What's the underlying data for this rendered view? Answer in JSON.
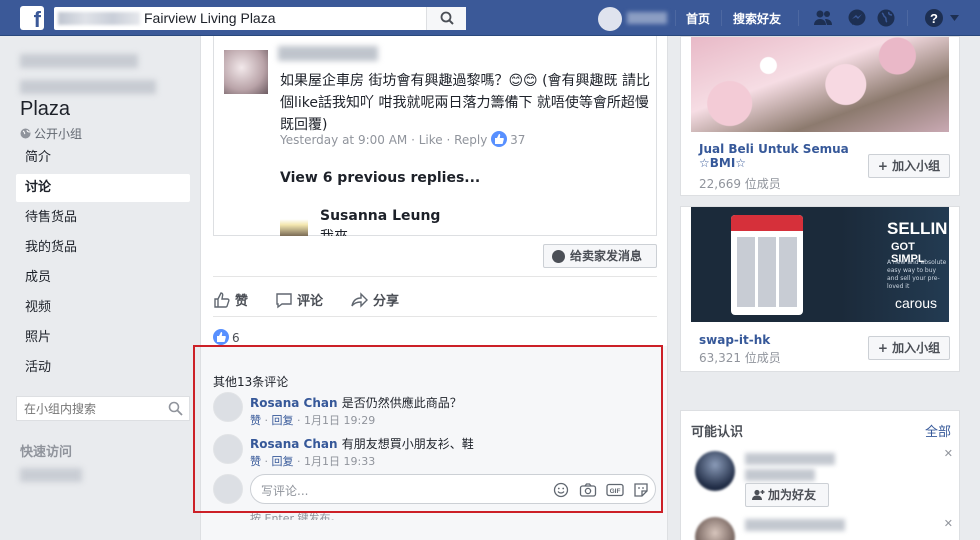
{
  "header": {
    "search_value": "Fairview Living Plaza",
    "nav_home": "首页",
    "nav_find_friends": "搜索好友"
  },
  "sidebar": {
    "group_name": "Plaza",
    "group_type": "公开小组",
    "items": [
      {
        "label": "简介",
        "active": false
      },
      {
        "label": "讨论",
        "active": true
      },
      {
        "label": "待售货品",
        "active": false
      },
      {
        "label": "我的货品",
        "active": false
      },
      {
        "label": "成员",
        "active": false
      },
      {
        "label": "视频",
        "active": false
      },
      {
        "label": "照片",
        "active": false
      },
      {
        "label": "活动",
        "active": false
      }
    ],
    "search_placeholder": "在小组内搜索",
    "quick_access": "快速访问"
  },
  "post": {
    "comment_text": "如果屋企車房 街坊會有興趣過黎嗎？😊😊 (會有興趣既 請比個like話我知吖 咁我就呢兩日落力籌備下 就唔使等會所超慢既回覆)",
    "comment_time": "Yesterday at 9:00 AM",
    "comment_like": "Like",
    "comment_reply": "Reply",
    "comment_likes": "37",
    "view_previous": "View 6 previous replies...",
    "reply_author": "Susanna Leung",
    "reply_text": "我來",
    "message_seller": "给卖家发消息",
    "actions": {
      "like": "赞",
      "comment": "评论",
      "share": "分享"
    },
    "likes_count": "6"
  },
  "comments": {
    "more_label": "其他13条评论",
    "items": [
      {
        "author": "Rosana Chan",
        "text": "是否仍然供應此商品？",
        "like": "赞",
        "reply": "回复",
        "time": "1月1日 19:29"
      },
      {
        "author": "Rosana Chan",
        "text": "有朋友想買小朋友衫、鞋",
        "like": "赞",
        "reply": "回复",
        "time": "1月1日 19:33"
      }
    ],
    "input_placeholder": "写评论...",
    "press_enter": "按 Enter 键发布。"
  },
  "right": {
    "groups": [
      {
        "name": "Jual Beli Untuk Semua ☆BMI☆",
        "members": "22,669 位成员",
        "join": "+ 加入小组"
      },
      {
        "name": "swap-it-hk",
        "members": "63,321 位成员",
        "join": "+ 加入小组"
      }
    ],
    "ad_sell": "SELLIN",
    "ad_simple": "GOT SIMPL",
    "ad_small": "A new and absolute easy way to buy and sell your pre-loved it",
    "ad_brand": "carous",
    "pymk_title": "可能认识",
    "pymk_all": "全部",
    "add_friend": "加为好友"
  }
}
